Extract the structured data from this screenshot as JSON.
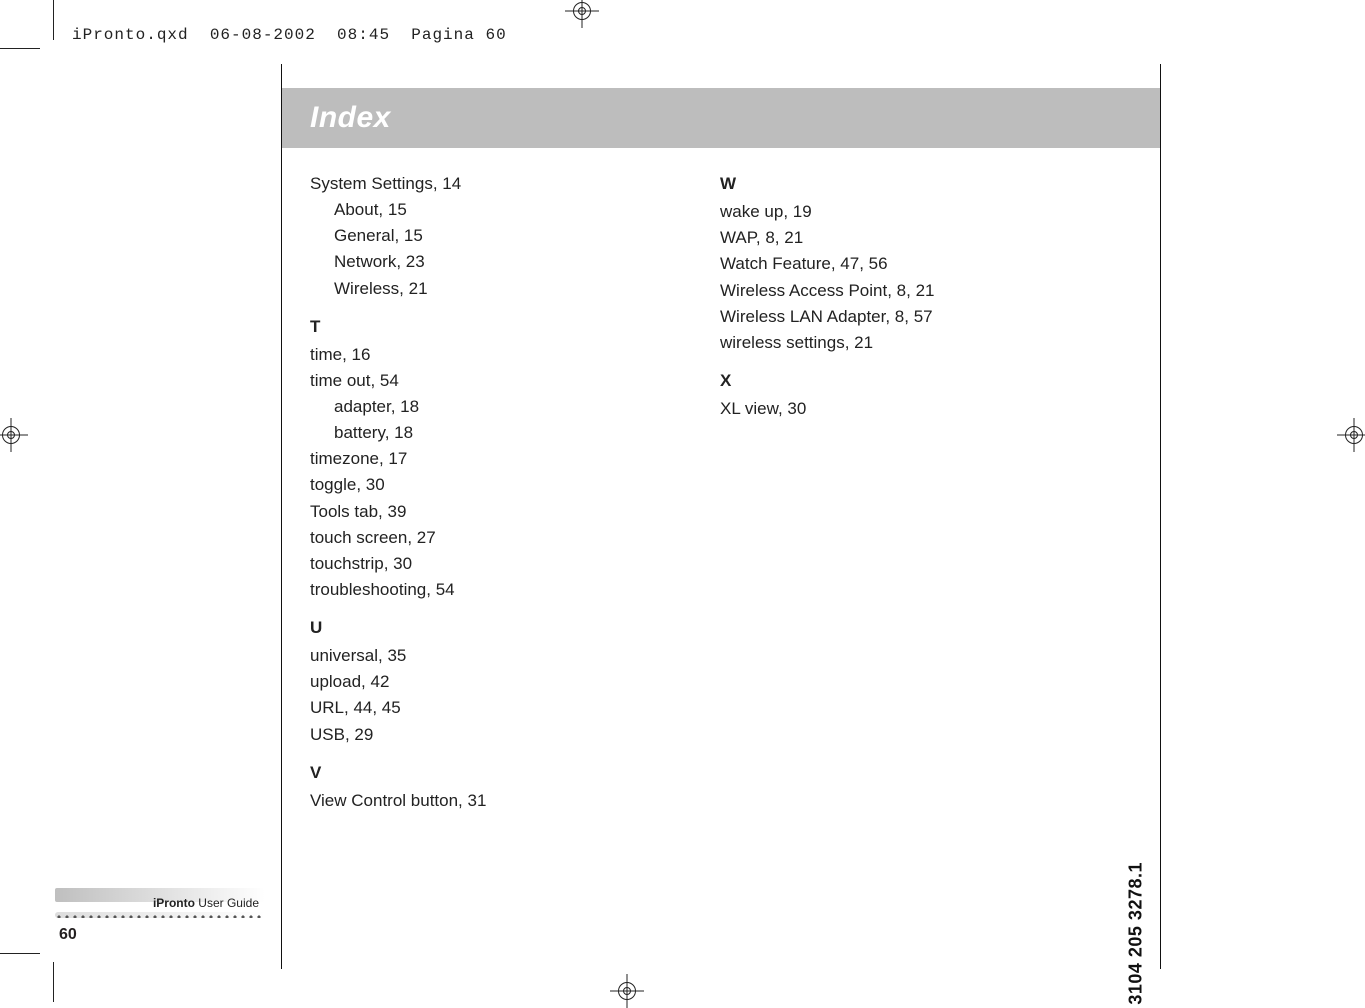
{
  "file_stamp": "iPronto.qxd  06-08-2002  08:45  Pagina 60",
  "title": "Index",
  "badge": {
    "product": "iPronto",
    "guide": "User Guide",
    "page": "60"
  },
  "spine_code": "3104 205 3278.1",
  "col1": {
    "pre": [
      {
        "text": "System Settings, 14",
        "indent": false
      },
      {
        "text": "About, 15",
        "indent": true
      },
      {
        "text": "General, 15",
        "indent": true
      },
      {
        "text": "Network, 23",
        "indent": true
      },
      {
        "text": "Wireless, 21",
        "indent": true
      }
    ],
    "T_label": "T",
    "T": [
      {
        "text": "time, 16",
        "indent": false
      },
      {
        "text": "time out, 54",
        "indent": false
      },
      {
        "text": "adapter, 18",
        "indent": true
      },
      {
        "text": "battery, 18",
        "indent": true
      },
      {
        "text": "timezone, 17",
        "indent": false
      },
      {
        "text": "toggle, 30",
        "indent": false
      },
      {
        "text": "Tools tab, 39",
        "indent": false
      },
      {
        "text": "touch screen, 27",
        "indent": false
      },
      {
        "text": "touchstrip, 30",
        "indent": false
      },
      {
        "text": "troubleshooting, 54",
        "indent": false
      }
    ],
    "U_label": "U",
    "U": [
      {
        "text": "universal, 35",
        "indent": false
      },
      {
        "text": "upload, 42",
        "indent": false
      },
      {
        "text": "URL, 44, 45",
        "indent": false
      },
      {
        "text": "USB, 29",
        "indent": false
      }
    ],
    "V_label": "V",
    "V": [
      {
        "text": "View Control button, 31",
        "indent": false
      }
    ]
  },
  "col2": {
    "W_label": "W",
    "W": [
      {
        "text": "wake up, 19",
        "indent": false
      },
      {
        "text": "WAP, 8, 21",
        "indent": false
      },
      {
        "text": "Watch Feature, 47, 56",
        "indent": false
      },
      {
        "text": "Wireless Access Point, 8, 21",
        "indent": false
      },
      {
        "text": "Wireless LAN Adapter, 8, 57",
        "indent": false
      },
      {
        "text": "wireless settings, 21",
        "indent": false
      }
    ],
    "X_label": "X",
    "X": [
      {
        "text": "XL view, 30",
        "indent": false
      }
    ]
  }
}
